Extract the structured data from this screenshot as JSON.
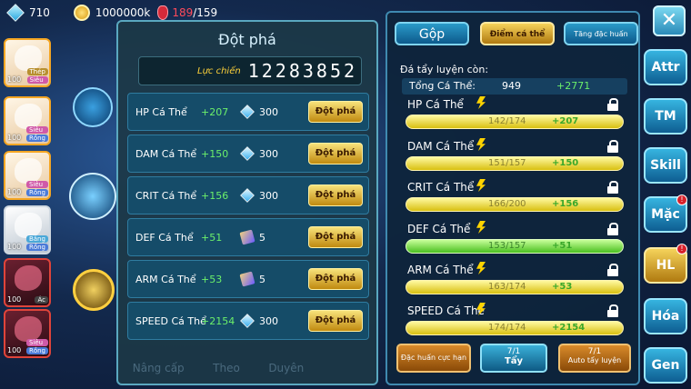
{
  "topbar": {
    "gems": "710",
    "coins": "1000000k",
    "stamina_current": "189",
    "stamina_max": "/159"
  },
  "party": [
    {
      "level": "100",
      "types": [
        "Thép",
        "Siêu"
      ],
      "style": "gold"
    },
    {
      "level": "100",
      "types": [
        "Siêu",
        "Rồng"
      ],
      "style": "gold"
    },
    {
      "level": "100",
      "types": [
        "Siêu",
        "Rồng"
      ],
      "style": "gold"
    },
    {
      "level": "100",
      "types": [
        "Băng",
        "Rồng"
      ],
      "style": "silver"
    },
    {
      "level": "100",
      "types": [
        "Ác"
      ],
      "style": "dark"
    },
    {
      "level": "100",
      "types": [
        "Siêu",
        "Rồng"
      ],
      "style": "dark"
    }
  ],
  "breakthrough": {
    "title": "Đột phá",
    "power_label": "Lực chiến",
    "power_value": "12283852",
    "rows": [
      {
        "label": "HP Cá Thể",
        "bonus": "+207",
        "cost_icon": "diamond-icon",
        "cost": "300",
        "button": "Đột phá"
      },
      {
        "label": "DAM Cá Thể",
        "bonus": "+150",
        "cost_icon": "diamond-icon",
        "cost": "300",
        "button": "Đột phá"
      },
      {
        "label": "CRIT Cá Thể",
        "bonus": "+156",
        "cost_icon": "diamond-icon",
        "cost": "300",
        "button": "Đột phá"
      },
      {
        "label": "DEF Cá Thể",
        "bonus": "+51",
        "cost_icon": "scroll-icon",
        "cost": "5",
        "button": "Đột phá"
      },
      {
        "label": "ARM Cá Thể",
        "bonus": "+53",
        "cost_icon": "scroll-icon",
        "cost": "5",
        "button": "Đột phá"
      },
      {
        "label": "SPEED Cá Thể",
        "bonus": "+2154",
        "cost_icon": "diamond-icon",
        "cost": "300",
        "button": "Đột phá"
      }
    ]
  },
  "bottom_tabs": [
    "Nâng cấp",
    "Theo",
    "Duyên"
  ],
  "right_panel": {
    "tabs": [
      "Gộp",
      "Điểm cá thể",
      "Tăng đặc huấn"
    ],
    "active_tab": "Điểm cá thể",
    "subtitle": "Đá tẩy luyện còn:",
    "total_label": "Tổng Cá Thể:",
    "total_value": "949",
    "total_bonus": "+2771",
    "stats": [
      {
        "label": "HP Cá Thể",
        "value": "142/174",
        "bonus": "+207",
        "fill": 0.82,
        "color": "yellow"
      },
      {
        "label": "DAM Cá Thể",
        "value": "151/157",
        "bonus": "+150",
        "fill": 0.96,
        "color": "yellow"
      },
      {
        "label": "CRIT Cá Thể",
        "value": "166/200",
        "bonus": "+156",
        "fill": 0.83,
        "color": "yellow"
      },
      {
        "label": "DEF Cá Thể",
        "value": "153/157",
        "bonus": "+51",
        "fill": 0.97,
        "color": "green"
      },
      {
        "label": "ARM Cá Thể",
        "value": "163/174",
        "bonus": "+53",
        "fill": 0.94,
        "color": "yellow"
      },
      {
        "label": "SPEED Cá Thể",
        "value": "174/174",
        "bonus": "+2154",
        "fill": 1.0,
        "color": "yellow"
      }
    ],
    "buttons": {
      "dac_huan": "Đặc huấn cực hạn",
      "tay_count": "7/1",
      "tay_label": "Tẩy",
      "auto_count": "7/1",
      "auto_label": "Auto tẩy luyện"
    }
  },
  "side_menu": [
    {
      "label": "Attr",
      "style": "blue",
      "badge": false
    },
    {
      "label": "TM",
      "style": "blue",
      "badge": false
    },
    {
      "label": "Skill",
      "style": "blue",
      "badge": false
    },
    {
      "label": "Mặc",
      "style": "blue",
      "badge": true
    },
    {
      "label": "HL",
      "style": "gold",
      "badge": true
    },
    {
      "label": "Hóa",
      "style": "blue",
      "badge": false
    },
    {
      "label": "Gen",
      "style": "blue",
      "badge": false
    }
  ],
  "badge_text": "!",
  "close_label": "✕"
}
